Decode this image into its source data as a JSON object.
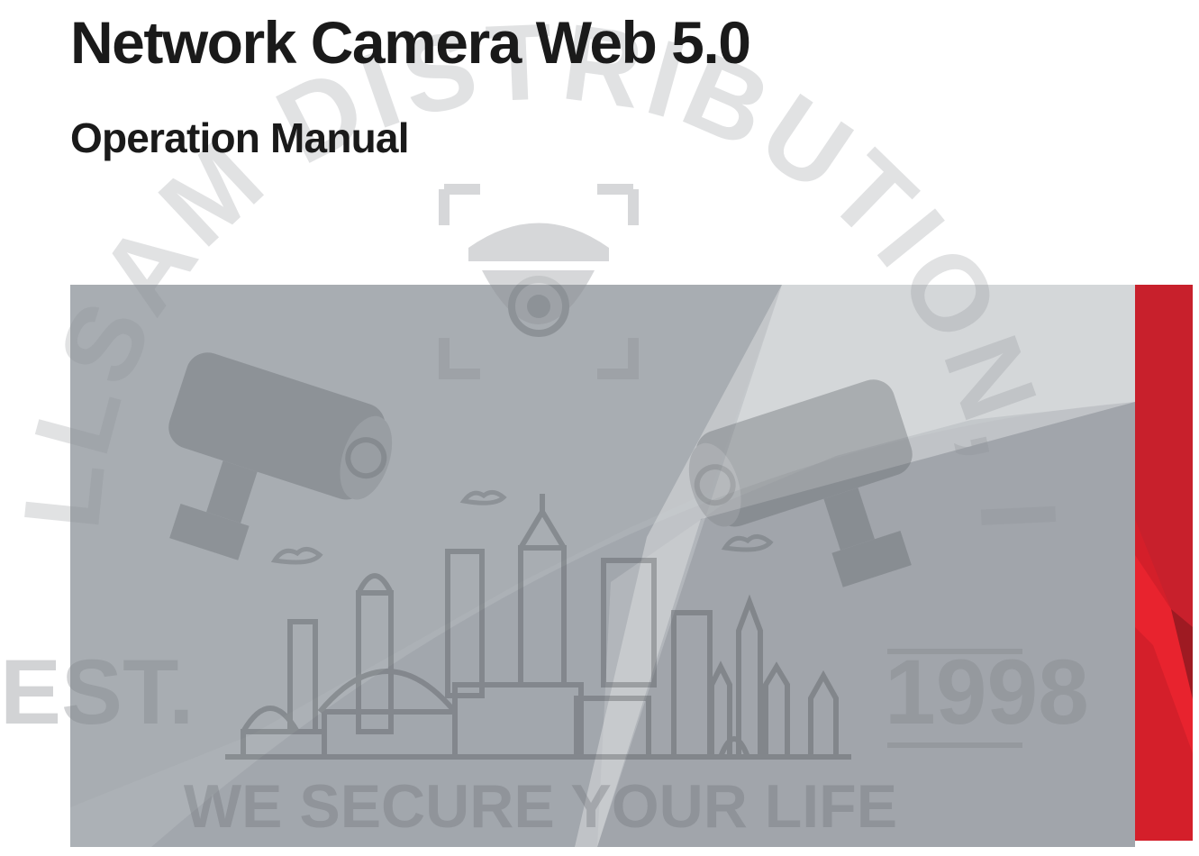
{
  "document": {
    "title": "Network Camera Web 5.0",
    "subtitle": "Operation Manual"
  },
  "watermark": {
    "arc_text": "COLLSAM DISTRIBUTION, INC",
    "est_label": "EST.",
    "year_label": "1998",
    "slogan": "WE SECURE YOUR LIFE"
  },
  "colors": {
    "panel": "#a8adb2",
    "accent_red": "#c8202c"
  }
}
